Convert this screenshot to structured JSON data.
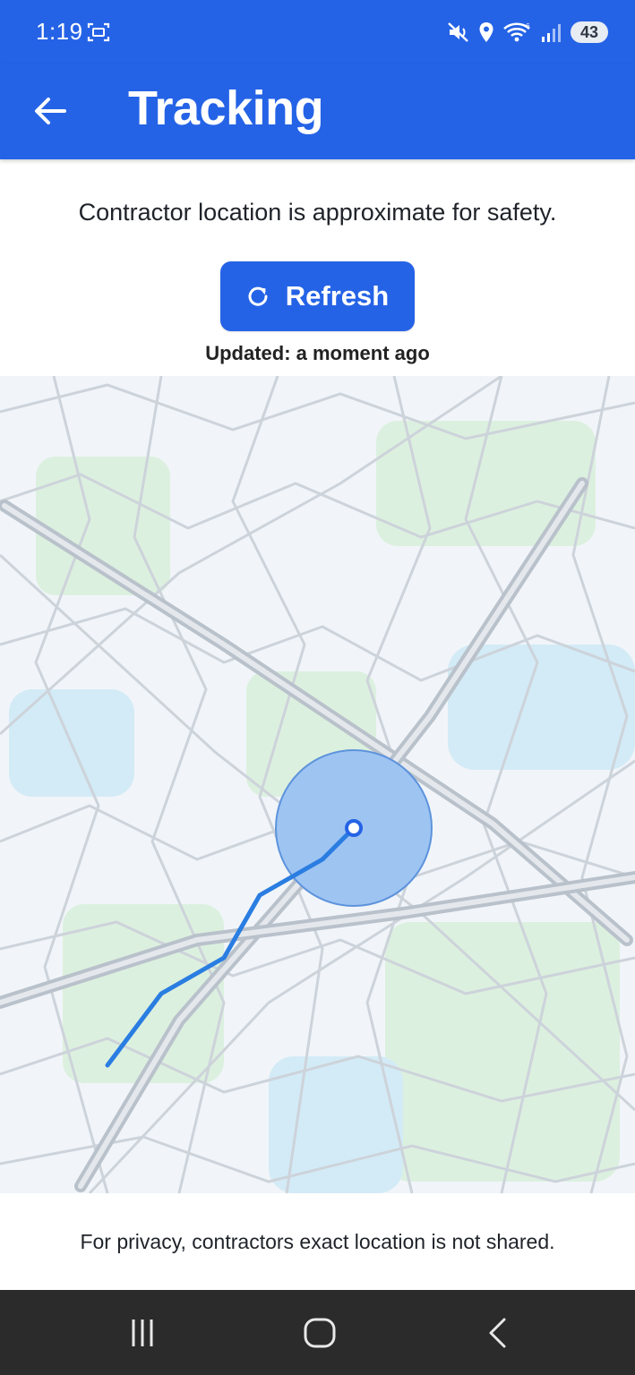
{
  "status_bar": {
    "time": "1:19",
    "battery": "43",
    "icons": [
      "screenshot-icon",
      "mute-icon",
      "location-icon",
      "wifi-icon",
      "signal-icon"
    ]
  },
  "app_bar": {
    "title": "Tracking",
    "back_icon": "arrow-left-icon",
    "color": "#2563e6"
  },
  "content": {
    "notice": "Contractor location is approximate for safety.",
    "refresh_label": "Refresh",
    "refresh_icon": "refresh-icon",
    "updated": "Updated: a moment ago",
    "footer": "For privacy, contractors exact location is not shared."
  },
  "map": {
    "accent": "#2a7de1",
    "approx_area_color": "#9ec4f2"
  },
  "nav_bar": {
    "buttons": [
      "recent-apps-icon",
      "home-icon",
      "back-nav-icon"
    ]
  }
}
